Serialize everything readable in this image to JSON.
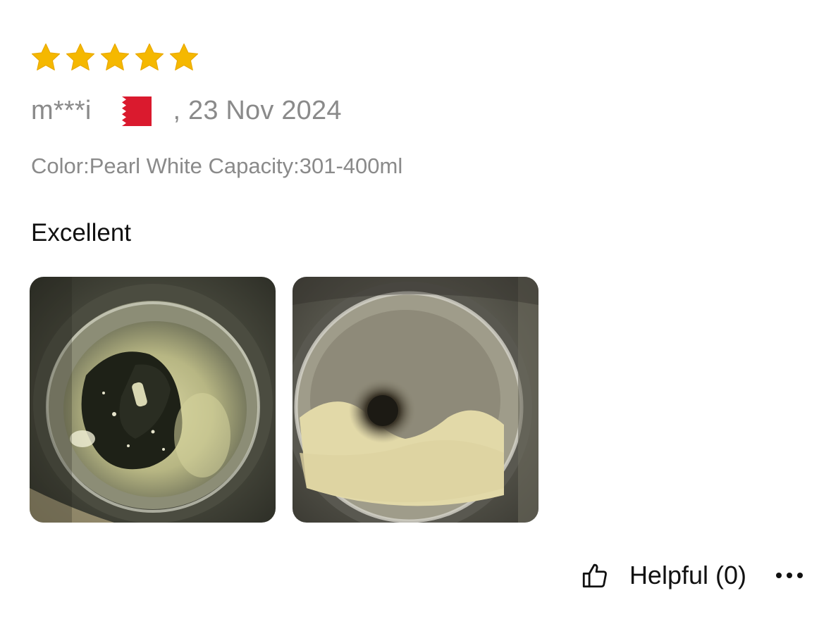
{
  "review": {
    "rating": 5,
    "rating_max": 5,
    "star_color": "#f5b800",
    "reviewer": "m***i",
    "country_flag": "bahrain-flag-icon",
    "date": ", 23 Nov 2024",
    "sku": "Color:Pearl White Capacity:301-400ml",
    "text": "Excellent",
    "photos": [
      {
        "name": "review-photo-1",
        "description_icon": "photo"
      },
      {
        "name": "review-photo-2",
        "description_icon": "photo"
      }
    ]
  },
  "footer": {
    "helpful_label": "Helpful (0)",
    "thumb_icon": "thumbs-up-icon",
    "more_icon": "more-options-icon"
  }
}
